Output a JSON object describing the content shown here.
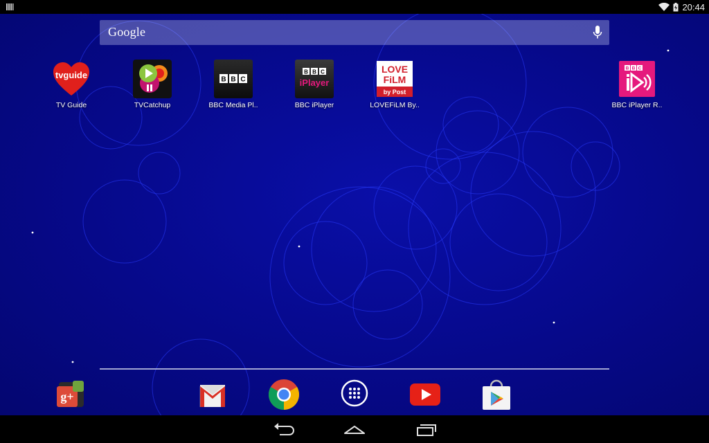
{
  "status_bar": {
    "time": "20:44",
    "icons": [
      "notification-icon",
      "wifi-icon",
      "battery-icon"
    ]
  },
  "search": {
    "label": "Google",
    "icons": [
      "mic-icon"
    ]
  },
  "apps": [
    {
      "label": "TV Guide",
      "icon": "tv-guide-icon"
    },
    {
      "label": "TVCatchup",
      "icon": "tvcatchup-icon"
    },
    {
      "label": "BBC Media Pl..",
      "icon": "bbc-media-player-icon"
    },
    {
      "label": "BBC iPlayer",
      "icon": "bbc-iplayer-icon"
    },
    {
      "label": "LOVEFiLM By..",
      "icon": "lovefilm-icon"
    },
    {
      "label": "BBC iPlayer R..",
      "icon": "bbc-iplayer-radio-icon"
    }
  ],
  "icon_text": {
    "tvguide": "tvguide",
    "bbc": "BBC",
    "iplayer": "iPlayer",
    "love": "LOVE",
    "film": "FiLM",
    "bypost": "by Post",
    "gplus": "g+"
  },
  "dock": [
    {
      "icon": "google-plus-icon"
    },
    {
      "icon": "gmail-icon"
    },
    {
      "icon": "chrome-icon"
    },
    {
      "icon": "app-drawer-icon"
    },
    {
      "icon": "youtube-icon"
    },
    {
      "icon": "play-store-icon"
    }
  ],
  "nav": [
    {
      "icon": "back-icon"
    },
    {
      "icon": "home-icon"
    },
    {
      "icon": "recents-icon"
    }
  ],
  "colors": {
    "wallpaper": "#06098a",
    "tvguide_red": "#e0201c",
    "bbc_iplayer_pink": "#e5197d",
    "youtube_red": "#e62117",
    "gplus_red": "#dd4b39"
  }
}
